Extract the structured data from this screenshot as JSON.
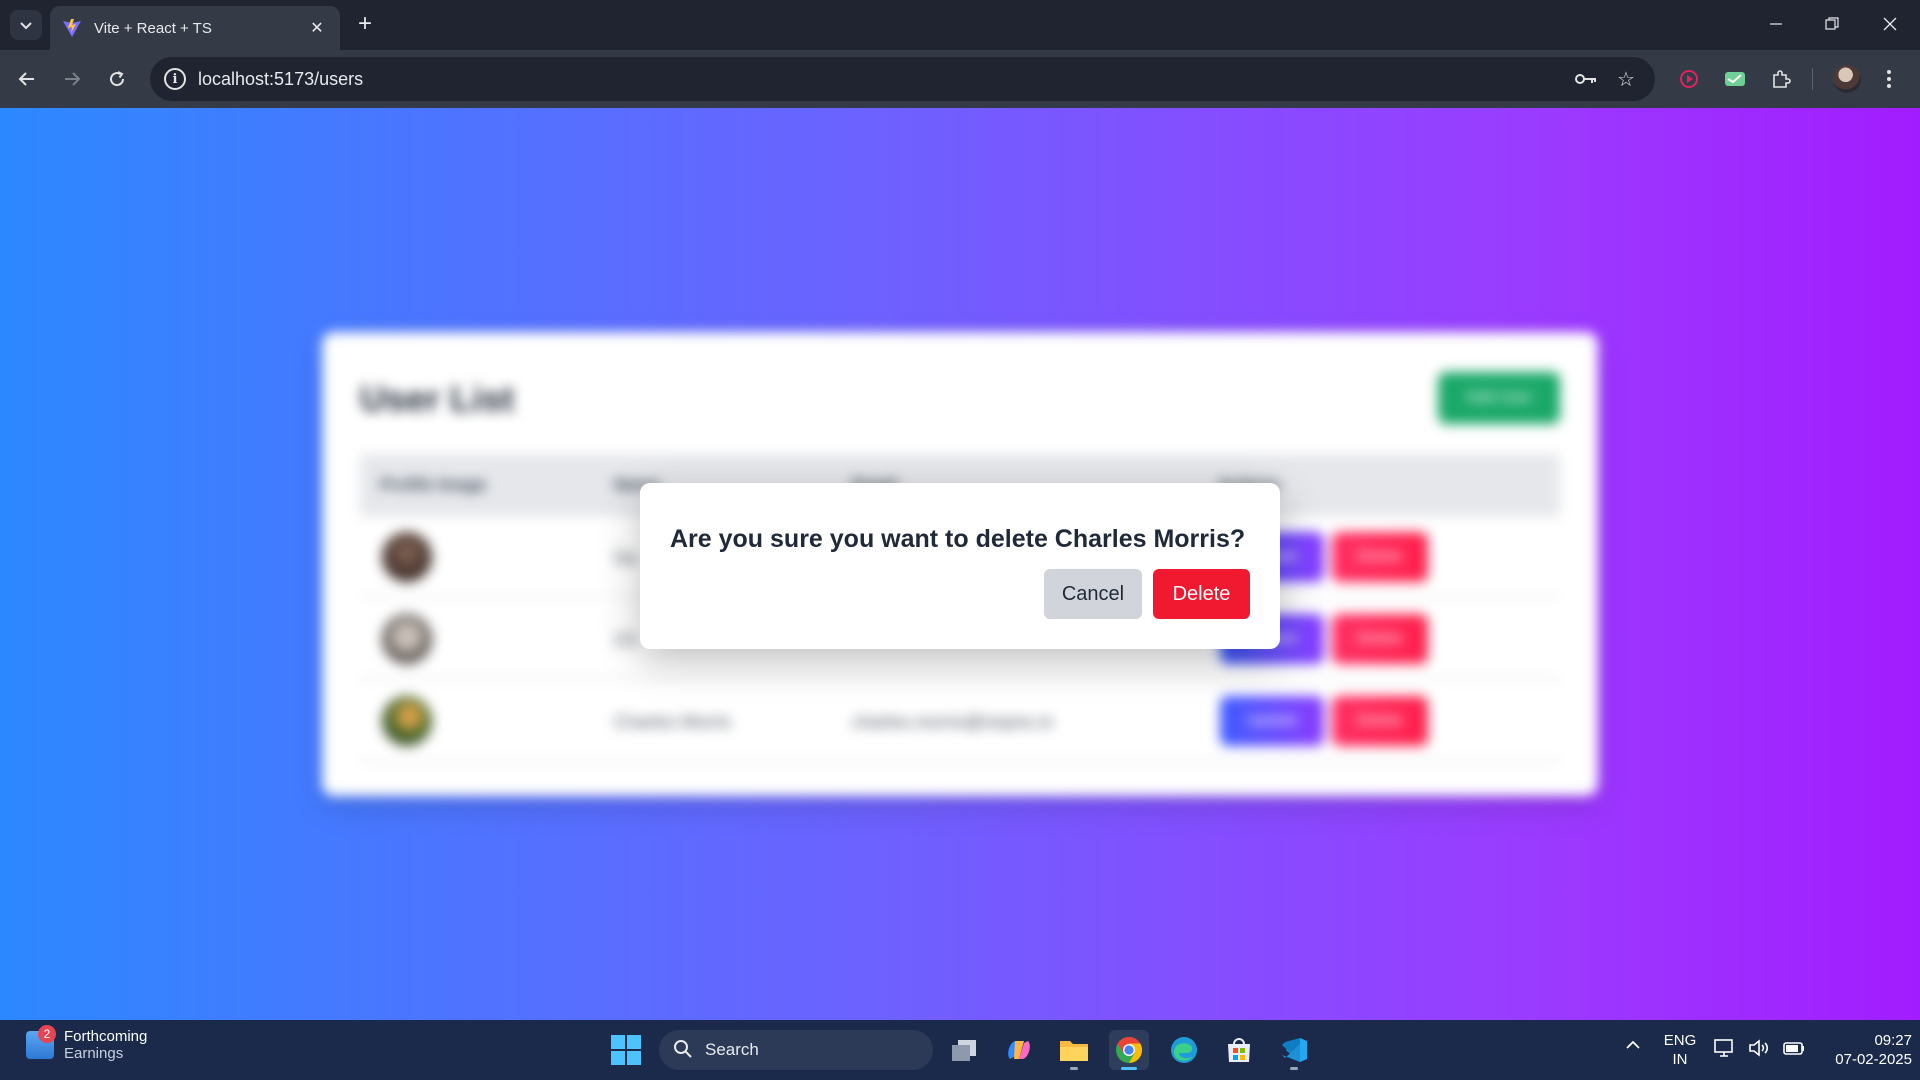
{
  "browser": {
    "tab_title": "Vite + React + TS",
    "url": "localhost:5173/users"
  },
  "page": {
    "card_title": "User List",
    "add_button": "Add User",
    "columns": [
      "Profile Image",
      "Name",
      "Email",
      "Actions"
    ],
    "rows": [
      {
        "name": "Da",
        "email": "",
        "update": "Update",
        "delete": "Delete"
      },
      {
        "name": "Ch",
        "email": "",
        "update": "Update",
        "delete": "Delete"
      },
      {
        "name": "Charles Morris",
        "email": "charles.morris@reqres.in",
        "update": "Update",
        "delete": "Delete"
      }
    ]
  },
  "modal": {
    "message": "Are you sure you want to delete Charles Morris?",
    "cancel_label": "Cancel",
    "delete_label": "Delete"
  },
  "taskbar": {
    "widget_badge": "2",
    "widget_title": "Forthcoming",
    "widget_subtitle": "Earnings",
    "search_label": "Search",
    "lang_top": "ENG",
    "lang_bottom": "IN",
    "time": "09:27",
    "date": "07-02-2025"
  },
  "colors": {
    "gradient_start": "#2c88ff",
    "gradient_end": "#a21cff",
    "delete_red": "#f0192f",
    "cancel_gray": "#d1d5db"
  }
}
